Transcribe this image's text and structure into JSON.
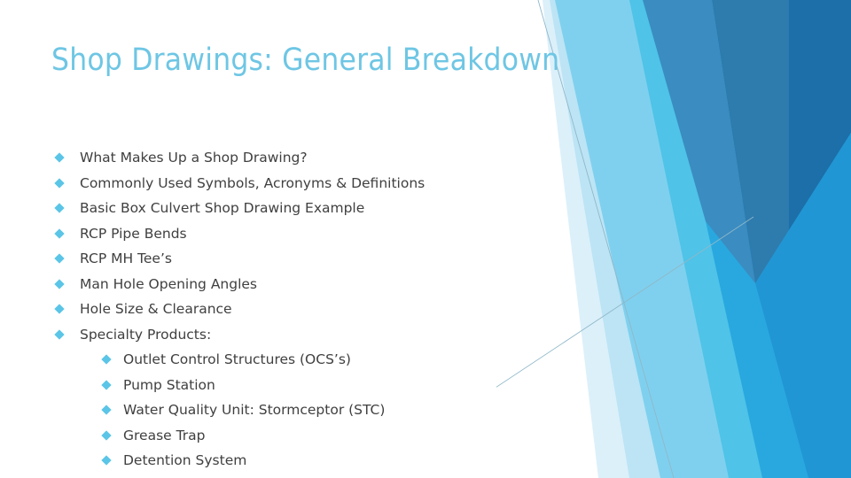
{
  "slide": {
    "title": "Shop Drawings: General Breakdown",
    "title_color": "#6EC6E4",
    "body_text_color": "#404040",
    "bullet_color": "#5BC5E7",
    "background_color": "#FFFFFF"
  },
  "content": {
    "level1": [
      {
        "label": "What Makes Up a Shop Drawing?"
      },
      {
        "label": "Commonly Used Symbols, Acronyms & Definitions"
      },
      {
        "label": "Basic Box Culvert Shop Drawing Example"
      },
      {
        "label": "RCP Pipe Bends"
      },
      {
        "label": "RCP MH Tee’s"
      },
      {
        "label": "Man Hole Opening Angles"
      },
      {
        "label": "Hole Size & Clearance"
      },
      {
        "label": "Specialty Products:"
      }
    ],
    "level2": [
      {
        "label": "Outlet Control Structures (OCS’s)"
      },
      {
        "label": "Pump Station"
      },
      {
        "label": "Water Quality Unit: Stormceptor (STC)"
      },
      {
        "label": "Grease Trap"
      },
      {
        "label": "Detention System"
      }
    ]
  },
  "decoration": {
    "name": "angled-blue-bands-graphic",
    "colors": {
      "pale_blue": "#DCF0FA",
      "light_blue": "#BCE4F5",
      "sky_blue": "#7FD0EE",
      "azure": "#4FC3E8",
      "medium_blue": "#29A8DF",
      "steel_blue": "#3A8CC1",
      "deep_blue": "#2E7BAE",
      "dark_blue": "#1C6FA8",
      "hairline": "#8FB8C9"
    }
  }
}
